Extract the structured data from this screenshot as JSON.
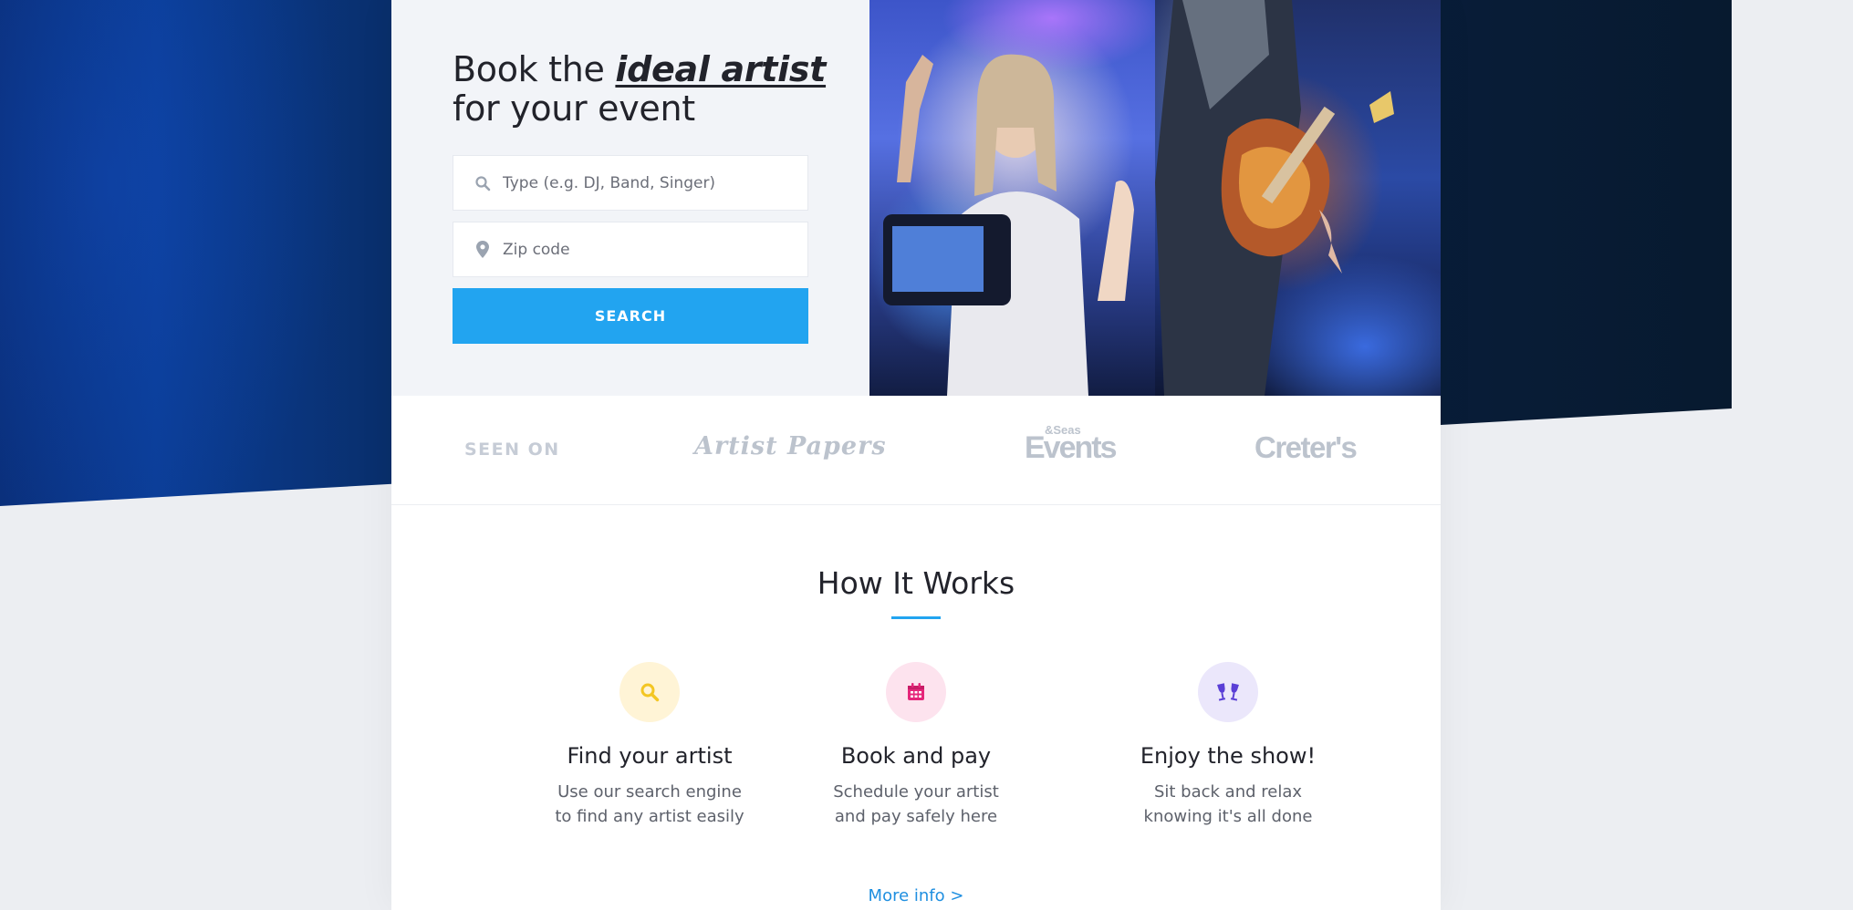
{
  "hero": {
    "headline_line1_prefix": "Book the ",
    "headline_line1_accent": "ideal artist",
    "headline_line2": "for your event",
    "type_placeholder": "Type (e.g. DJ, Band, Singer)",
    "zip_placeholder": "Zip code",
    "search_label": "SEARCH",
    "icons": {
      "type_field": "search-icon",
      "zip_field": "map-pin-icon"
    }
  },
  "seen_on": {
    "label": "SEEN ON",
    "logos": [
      {
        "text": "Artist Papers"
      },
      {
        "text": "Events",
        "superscript": "&Seas"
      },
      {
        "text": "Creter's"
      }
    ]
  },
  "how_it_works": {
    "title": "How It Works",
    "steps": [
      {
        "title": "Find your artist",
        "desc_line1": "Use our search engine",
        "desc_line2": "to find any artist easily",
        "icon": "search-icon",
        "icon_color": "#f3c623",
        "bg_color": "#fff4d6"
      },
      {
        "title": "Book and pay",
        "desc_line1": "Schedule your artist",
        "desc_line2": "and pay safely here",
        "icon": "calendar-icon",
        "icon_color": "#e5267a",
        "bg_color": "#fde3ee"
      },
      {
        "title": "Enjoy the show!",
        "desc_line1": "Sit back and relax",
        "desc_line2": "knowing it's all done",
        "icon": "cheers-glasses-icon",
        "icon_color": "#5a3fd6",
        "bg_color": "#ebe7fb"
      }
    ],
    "more_info": "More info >"
  },
  "colors": {
    "accent": "#22a4f0",
    "dark_band": "#0a2045",
    "text": "#22232b"
  }
}
